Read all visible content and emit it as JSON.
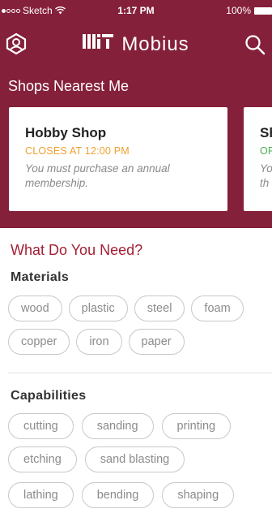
{
  "status": {
    "carrier": "Sketch",
    "time": "1:17 PM",
    "battery": "100%"
  },
  "header": {
    "logo_mit": "MIT",
    "logo_mobius": "Mobius"
  },
  "nearest": {
    "title": "Shops Nearest Me",
    "cards": [
      {
        "name": "Hobby Shop",
        "hours": "CLOSES AT 12:00 PM",
        "description": "You must purchase an annual membership."
      },
      {
        "name": "Sh",
        "hours": "OP",
        "description_line1": "Yo",
        "description_line2": "th"
      }
    ]
  },
  "need": {
    "title": "What Do You Need?",
    "materials": {
      "title": "Materials",
      "rows": [
        [
          "wood",
          "plastic",
          "steel",
          "foam"
        ],
        [
          "copper",
          "iron",
          "paper"
        ]
      ]
    },
    "capabilities": {
      "title": "Capabilities",
      "rows": [
        [
          "cutting",
          "sanding",
          "printing"
        ],
        [
          "etching",
          "sand blasting"
        ],
        [
          "lathing",
          "bending",
          "shaping"
        ]
      ]
    }
  },
  "colors": {
    "brand": "#85203a",
    "accent_title": "#a31f34",
    "hours_closing": "#f0a030",
    "hours_open": "#4caf50"
  },
  "icons": {
    "left_nav": "profile-icon",
    "right_nav": "search-icon"
  }
}
